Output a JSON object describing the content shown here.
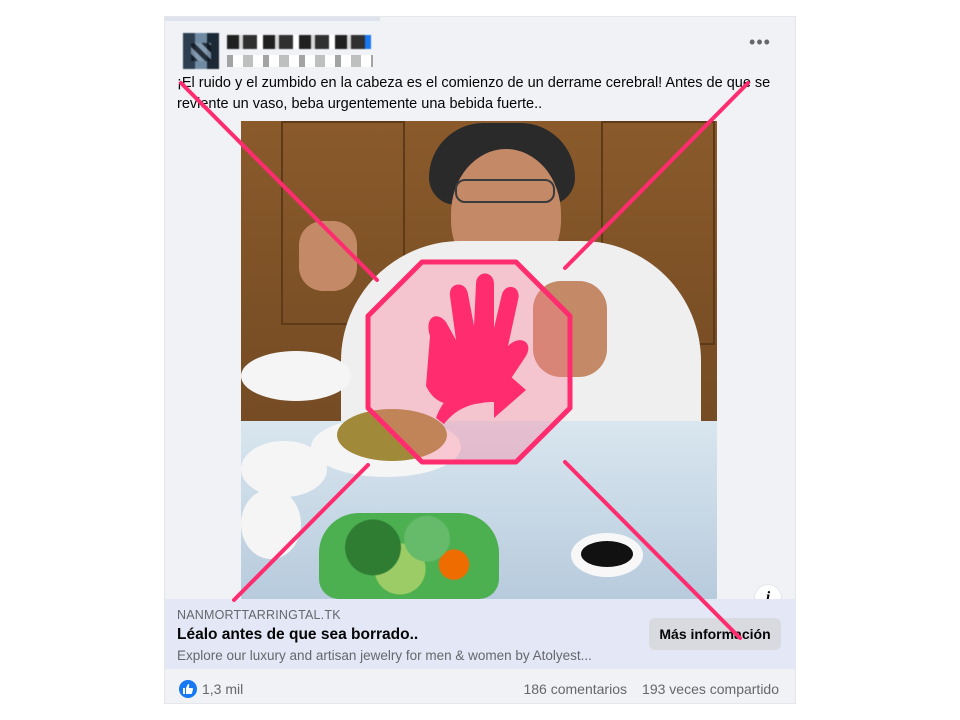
{
  "post": {
    "author_name": "",
    "author_meta": "",
    "text": "¡El ruido y el zumbido en la cabeza es el comienzo de un derrame cerebral! Antes de que se reviente un vaso, beba urgentemente una bebida fuerte..",
    "more_icon": "more-horizontal-icon"
  },
  "media": {
    "info_icon": "info-icon",
    "info_glyph": "i"
  },
  "link_preview": {
    "domain": "NANMORTTARRINGTAL.TK",
    "title": "Léalo antes de que sea borrado..",
    "description": "Explore our luxury and artisan jewelry for men & women by Atolyest...",
    "cta_label": "Más información"
  },
  "footer": {
    "like_icon": "like-icon",
    "reactions": "1,3 mil",
    "comments": "186 comentarios",
    "shares": "193 veces compartido"
  },
  "overlay": {
    "symbol": "stop-hand-share-icon",
    "accent_color": "#ff2d6f"
  }
}
